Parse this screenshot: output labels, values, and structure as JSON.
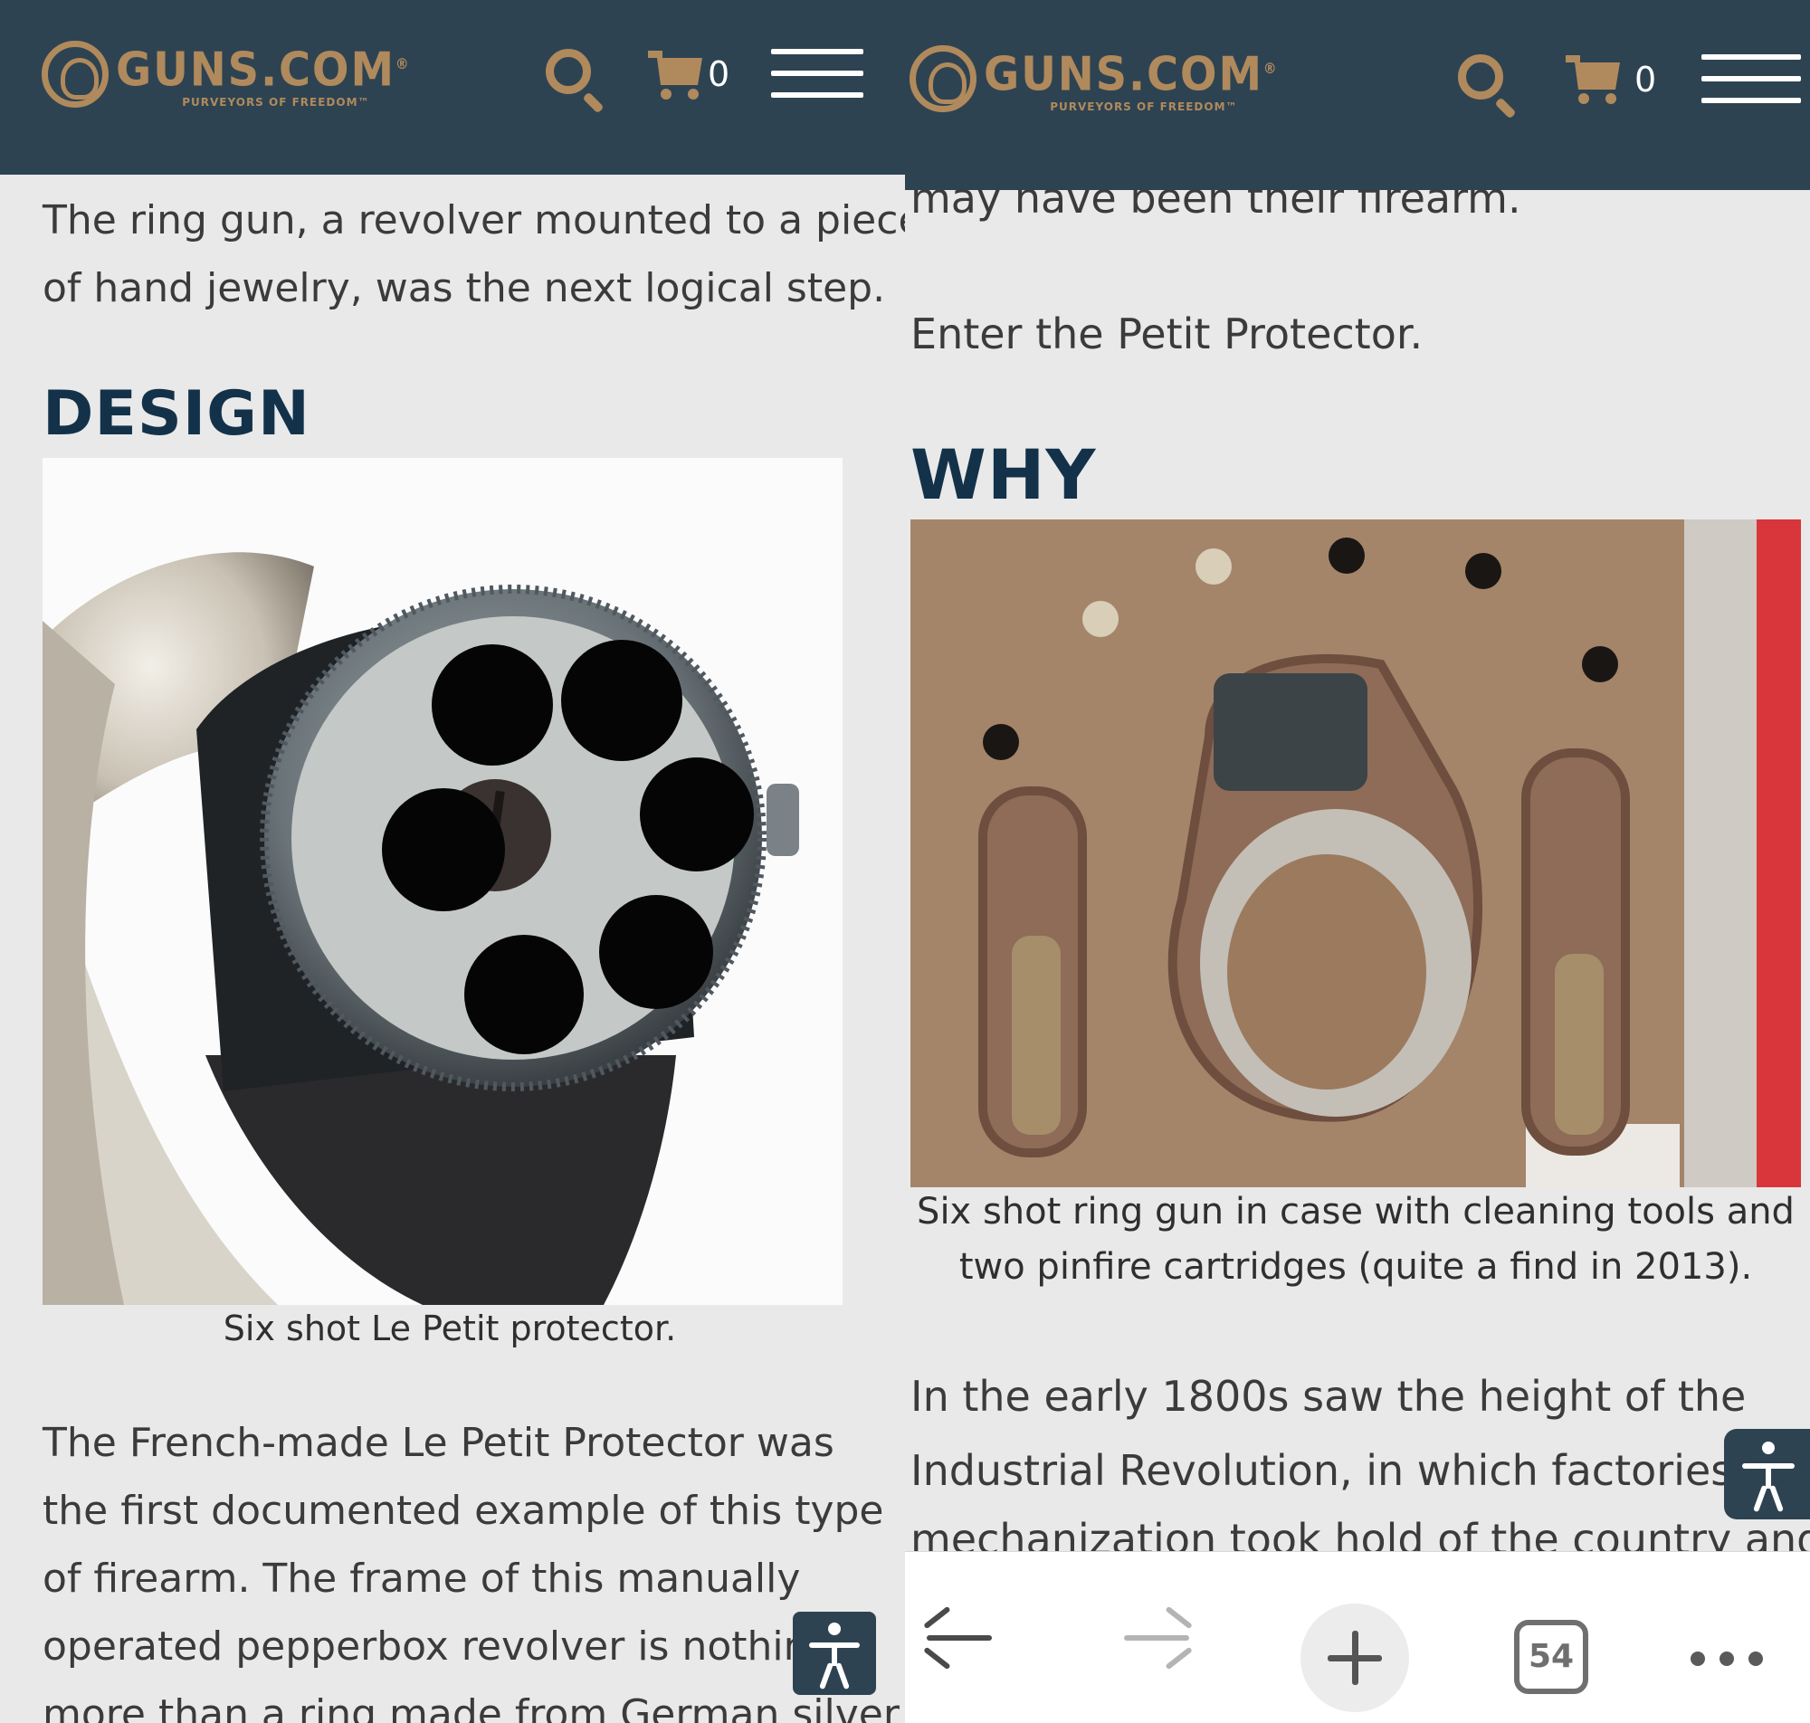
{
  "left": {
    "header": {
      "logo_text": "GUNS.COM",
      "logo_trademark": "®",
      "logo_tagline": "PURVEYORS OF FREEDOM™",
      "cart_count": "0"
    },
    "intro_lines": [
      "The ring gun, a revolver mounted to a piece",
      "of hand jewelry, was the next logical step."
    ],
    "section_heading": "DESIGN",
    "image_caption": "Six shot Le Petit protector.",
    "body_lines": [
      "The French-made Le Petit Protector was",
      "the first documented example of this type",
      "of firearm. The frame of this manually",
      "operated pepperbox revolver is nothing",
      "more than a ring made from German silver"
    ]
  },
  "right": {
    "header": {
      "logo_text": "GUNS.COM",
      "logo_trademark": "®",
      "logo_tagline": "PURVEYORS OF FREEDOM™",
      "cart_count": "0"
    },
    "partial_line": "may have been their firearm.",
    "enter_line": "Enter the Petit Protector.",
    "section_heading": "WHY",
    "image_caption_lines": [
      "Six shot ring gun in case with cleaning tools and",
      "two pinfire cartridges (quite a find in 2013)."
    ],
    "body_lines": [
      "In the early 1800s saw the height of the",
      "Industrial Revolution, in which factories",
      "mechanization took hold of the country and"
    ],
    "browser_bar": {
      "tab_count": "54"
    }
  },
  "colors": {
    "header_bg": "#2e4352",
    "brand_gold": "#b08a5c",
    "heading_navy": "#13324a",
    "page_bg": "#e9e9e9"
  },
  "icons": [
    "search-icon",
    "cart-icon",
    "menu-icon",
    "accessibility-icon",
    "back-arrow-icon",
    "forward-arrow-icon",
    "plus-icon",
    "tabs-icon",
    "more-icon"
  ]
}
